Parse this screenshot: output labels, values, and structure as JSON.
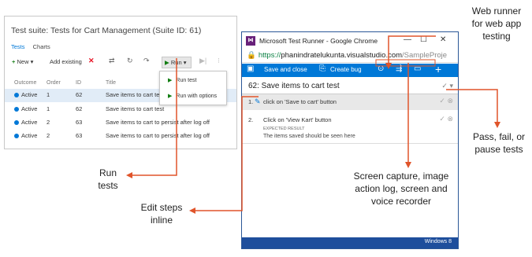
{
  "suite": {
    "title": "Test suite: Tests for Cart Management (Suite ID: 61)",
    "tabs": [
      "Tests",
      "Charts"
    ],
    "toolbar": {
      "new_label": "New",
      "add_existing_label": "Add existing",
      "run_label": "Run"
    },
    "columns": [
      "Outcome",
      "Order",
      "ID",
      "Title"
    ],
    "rows": [
      {
        "outcome": "Active",
        "order": "1",
        "id": "62",
        "title": "Save items to cart test"
      },
      {
        "outcome": "Active",
        "order": "1",
        "id": "62",
        "title": "Save items to cart test"
      },
      {
        "outcome": "Active",
        "order": "2",
        "id": "63",
        "title": "Save items to cart to persist after log off"
      },
      {
        "outcome": "Active",
        "order": "2",
        "id": "63",
        "title": "Save items to cart to persist after log off"
      }
    ],
    "run_menu": [
      "Run test",
      "Run with options"
    ]
  },
  "runner": {
    "window_title": "Microsoft Test Runner - Google Chrome",
    "url_scheme": "https://",
    "url_host": "phanindratelukunta.visualstudio.com",
    "url_path": "/SampleProje",
    "toolbar": {
      "save_close_label": "Save and close",
      "create_bug_label": "Create bug"
    },
    "test_title": "62: Save items to cart test",
    "steps": [
      {
        "num": "1.",
        "text": "click on 'Save to cart' button"
      },
      {
        "num": "2.",
        "text": "Click on 'View Kart' button",
        "expected_label": "EXPECTED RESULT",
        "expected": "The items saved should be seen here"
      }
    ],
    "status_text": "Windows 8"
  },
  "annotations": {
    "web_runner": [
      "Web runner",
      "for web app",
      "testing"
    ],
    "run_tests": [
      "Run",
      "tests"
    ],
    "edit_steps": [
      "Edit steps",
      "inline"
    ],
    "capture": [
      "Screen capture, image",
      "action log, screen and",
      "voice recorder"
    ],
    "pass_fail": [
      "Pass, fail, or",
      "pause tests"
    ]
  },
  "colors": {
    "accent": "#0078d7",
    "annotation_arrow": "#e0542a",
    "status_bar": "#1e4e9c"
  }
}
